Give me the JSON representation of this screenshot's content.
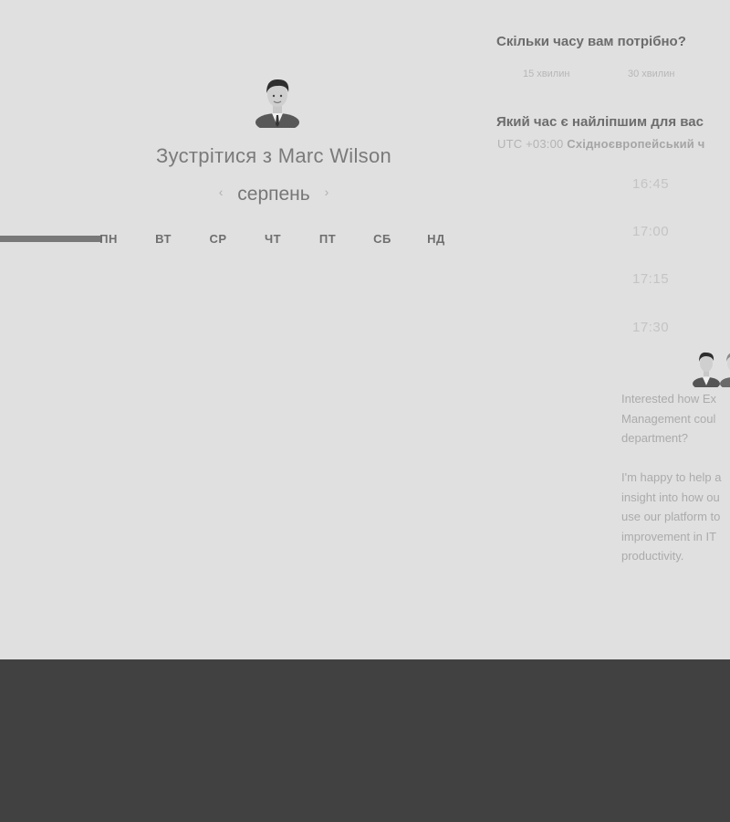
{
  "booking": {
    "title": "Зустрітися з Marc Wilson",
    "month": "серпень",
    "prev_symbol": "‹",
    "next_symbol": "›",
    "progress_fraction": 1.0,
    "weekdays": [
      "ПН",
      "ВТ",
      "СР",
      "ЧТ",
      "ПТ",
      "СБ",
      "НД"
    ]
  },
  "duration": {
    "question": "Скільки часу вам потрібно?",
    "options": [
      "15 хвилин",
      "30 хвилин"
    ]
  },
  "time": {
    "question": "Який час є найліпшим для вас",
    "timezone_offset": "UTC +03:00",
    "timezone_name": "Східноєвропейський ч",
    "slots": [
      "16:45",
      "17:00",
      "17:15",
      "17:30"
    ]
  },
  "description": {
    "paragraph1": "Interested how Ex\nManagement coul\ndepartment?",
    "paragraph2": "I'm happy to help a\ninsight into how ou\nuse our platform to\nimprovement in IT\nproductivity."
  },
  "colors": {
    "panel_background": "#e0e0e0",
    "footer_background": "#414141",
    "progress_fill": "#787878"
  },
  "icons": {
    "host_avatar": "person-portrait-icon",
    "prev": "chevron-left-icon",
    "next": "chevron-right-icon"
  }
}
